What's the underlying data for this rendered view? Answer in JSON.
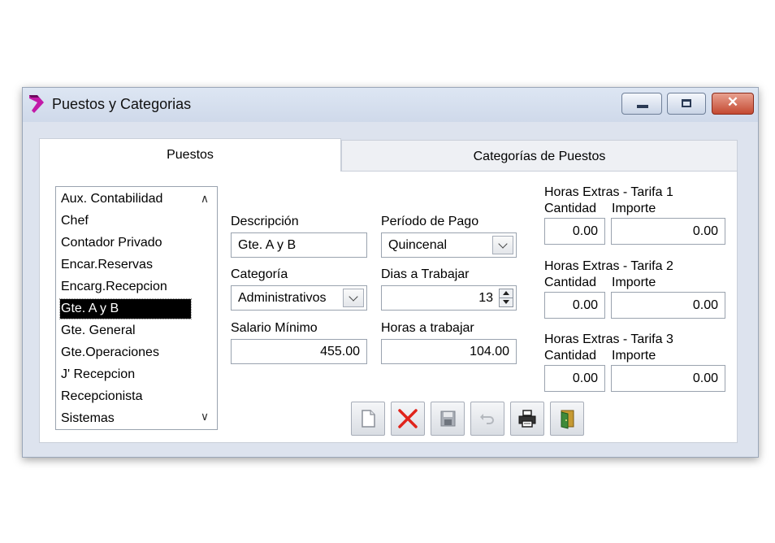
{
  "window": {
    "title": "Puestos y Categorias",
    "close_glyph": "✕"
  },
  "tabs": [
    {
      "label": "Puestos",
      "active": true
    },
    {
      "label": "Categorías de Puestos",
      "active": false
    }
  ],
  "list": {
    "items": [
      "Aux. Contabilidad",
      "Chef",
      "Contador Privado",
      "Encar.Reservas",
      "Encarg.Recepcion",
      "Gte. A y B",
      "Gte. General",
      "Gte.Operaciones",
      "J' Recepcion",
      "Recepcionista",
      "Sistemas"
    ],
    "selected": "Gte. A y B",
    "scroll_up": "∧",
    "scroll_down": "∨"
  },
  "form": {
    "descripcion_label": "Descripción",
    "descripcion_value": "Gte. A y B",
    "categoria_label": "Categoría",
    "categoria_value": "Administrativos",
    "salario_label": "Salario Mínimo",
    "salario_value": "455.00",
    "periodo_label": "Período de Pago",
    "periodo_value": "Quincenal",
    "dias_label": "Dias a Trabajar",
    "dias_value": "13",
    "horas_label": "Horas a trabajar",
    "horas_value": "104.00"
  },
  "extras": [
    {
      "title": "Horas Extras - Tarifa 1",
      "cantidad_label": "Cantidad",
      "importe_label": "Importe",
      "cantidad": "0.00",
      "importe": "0.00"
    },
    {
      "title": "Horas Extras - Tarifa 2",
      "cantidad_label": "Cantidad",
      "importe_label": "Importe",
      "cantidad": "0.00",
      "importe": "0.00"
    },
    {
      "title": "Horas Extras - Tarifa 3",
      "cantidad_label": "Cantidad",
      "importe_label": "Importe",
      "cantidad": "0.00",
      "importe": "0.00"
    }
  ],
  "toolbar": [
    "new-document-icon",
    "delete-icon",
    "save-icon",
    "undo-icon",
    "print-icon",
    "exit-door-icon"
  ],
  "colors": {
    "accent": "#c21aa8",
    "selection": "#000000",
    "delete_red": "#e0241b"
  }
}
